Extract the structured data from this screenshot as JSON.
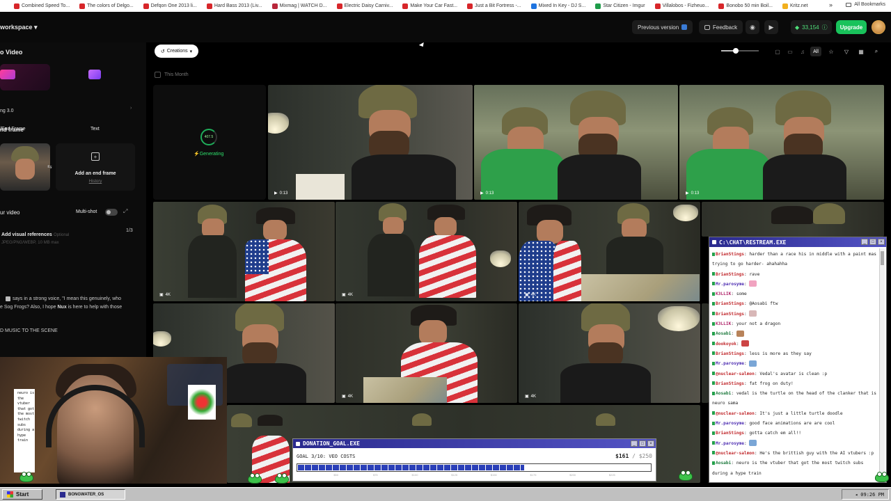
{
  "bookmarks": [
    {
      "label": "Combined Speed To...",
      "color": "#d7262a"
    },
    {
      "label": "The colors of Delgo...",
      "color": "#d7262a"
    },
    {
      "label": "Defqon One 2013 li...",
      "color": "#d7262a"
    },
    {
      "label": "Hard Bass 2013 (Liv...",
      "color": "#d7262a"
    },
    {
      "label": "Mixmag | WATCH D...",
      "color": "#b8263a"
    },
    {
      "label": "Electric Daisy Carniv...",
      "color": "#d7262a"
    },
    {
      "label": "Make Your Car Fast...",
      "color": "#d7262a"
    },
    {
      "label": "Just a Bit Fortress -...",
      "color": "#d7262a"
    },
    {
      "label": "Mixed In Key - DJ S...",
      "color": "#1e74e0"
    },
    {
      "label": "Star Citizen - Imgur",
      "color": "#1e9c4a"
    },
    {
      "label": "Villalobos - Fizheuo...",
      "color": "#d7262a"
    },
    {
      "label": "Bonobo 50 min Boil...",
      "color": "#d7262a"
    },
    {
      "label": "Kritz.net",
      "color": "#f2b01e"
    }
  ],
  "bookmarks_more": "»",
  "all_bookmarks": "All Bookmarks",
  "header": {
    "workspace": "workspace ▾",
    "previous_version": "Previous version",
    "feedback": "Feedback",
    "credits": "33,154",
    "upgrade": "Upgrade"
  },
  "sidebar": {
    "title": "o Video",
    "mode_start_end": "/End Frame",
    "mode_text": "Text",
    "model": "ng 3.0",
    "section_end_frame": "nd frame",
    "add_end_frame": "Add an end frame",
    "history": "History",
    "section_video": "ur video",
    "multishot": "Multi-shot",
    "add_visual_refs": "Add visual references",
    "optional": "Optional",
    "file_hint": "JPEG/PNG/WEBP, 10 MB max",
    "ref_count": "1/3",
    "prompt_main": "says in a strong voice, \"I mean this genuinely, who",
    "prompt_line2_a": "e Sog Frogs? Also, I hope ",
    "prompt_line2_name": "Nux",
    "prompt_line2_b": " is here to help with those",
    "prompt_music": "D MUSIC TO THE SCENE"
  },
  "toolbar": {
    "creations": "Creations",
    "this_month": "This Month",
    "all": "All",
    "zoom_level": 0.38
  },
  "generating": {
    "value": "407.5",
    "label": "Generating"
  },
  "tiles": [
    {
      "tag": "0:13"
    },
    {
      "tag": "0:13"
    },
    {
      "tag": "0:13"
    },
    {
      "tag": "4K"
    },
    {
      "tag": "4K"
    },
    {
      "tag": "4K"
    },
    {
      "tag": "4K"
    },
    {
      "tag": "4K"
    }
  ],
  "chat": {
    "title": "C:\\CHAT\\RESTREAM.EXE",
    "lines": [
      {
        "user": "BrianStings",
        "text": "harder than a race his in middle with a paint mask",
        "color": "#c0262a"
      },
      {
        "user": "",
        "text": "trying to go harder- ahahahha",
        "color": "#222"
      },
      {
        "user": "BrianStings",
        "text": "rave",
        "color": "#c0262a"
      },
      {
        "user": "Mr.parosyme",
        "text": "",
        "color": "#4b2ab0",
        "emote": "#f1a3c0"
      },
      {
        "user": "K3LLIK",
        "text": "some",
        "color": "#b0266b"
      },
      {
        "user": "BrianStings",
        "text": "@Aosabi ftw",
        "color": "#c0262a"
      },
      {
        "user": "BrianStings",
        "text": "",
        "color": "#c0262a",
        "emote": "#d8b7b7"
      },
      {
        "user": "K3LLIK",
        "text": "your not a dragon",
        "color": "#b0266b"
      },
      {
        "user": "Aosabi",
        "text": "",
        "color": "#1e7a3e",
        "emote": "#b8835a"
      },
      {
        "user": "dookoyok",
        "text": "",
        "color": "#c0262a",
        "emote": "#c44"
      },
      {
        "user": "BrianStings",
        "text": "less is more as they say",
        "color": "#c0262a"
      },
      {
        "user": "Mr.parosyme",
        "text": "",
        "color": "#4b2ab0",
        "emote": "#7aa6d6"
      },
      {
        "user": "@nuclear-salmon",
        "text": "Vedal's avatar is clean :p",
        "color": "#c0262a"
      },
      {
        "user": "BrianStings",
        "text": "fat frog on duty!",
        "color": "#c0262a"
      },
      {
        "user": "Aosabi",
        "text": "vedal is the turtle on the head of the clanker that is",
        "color": "#1e7a3e"
      },
      {
        "user": "",
        "text": "neuro sama",
        "color": "#222"
      },
      {
        "user": "@nuclear-salmon",
        "text": "It's just a little turtle doodle",
        "color": "#c0262a"
      },
      {
        "user": "Mr.parosyme",
        "text": "good face animations are are cool",
        "color": "#4b2ab0"
      },
      {
        "user": "BrianStings",
        "text": "gotta catch em all!!",
        "color": "#c0262a"
      },
      {
        "user": "Mr.parosyme",
        "text": "",
        "color": "#4b2ab0",
        "emote": "#7aa6d6"
      },
      {
        "user": "@nuclear-salmon",
        "text": "He's the brittish guy with the AI vtubers :p",
        "color": "#c0262a"
      },
      {
        "user": "Aosabi",
        "text": "neuro is the vtuber that got the most twitch subs",
        "color": "#1e7a3e"
      },
      {
        "user": "",
        "text": "during a hype train",
        "color": "#222"
      }
    ]
  },
  "webcam_caption": "neuro is the vtuber that got the most twitch subs during a hype train",
  "donation": {
    "title": "DONATION_GOAL.EXE",
    "goal": "GOAL 3/10: VEO COSTS",
    "current": "$161",
    "max": "/ $250",
    "progress": 0.644,
    "ticks": [
      "$50",
      "$75",
      "$100",
      "$125",
      "$150",
      "$175",
      "$200",
      "$225"
    ]
  },
  "taskbar": {
    "start": "Start",
    "item": "BONGWATER_OS",
    "clock": "09:26 PM"
  },
  "colors": {
    "accent_green": "#19c25b",
    "chat_title": "#2a2a8e"
  }
}
